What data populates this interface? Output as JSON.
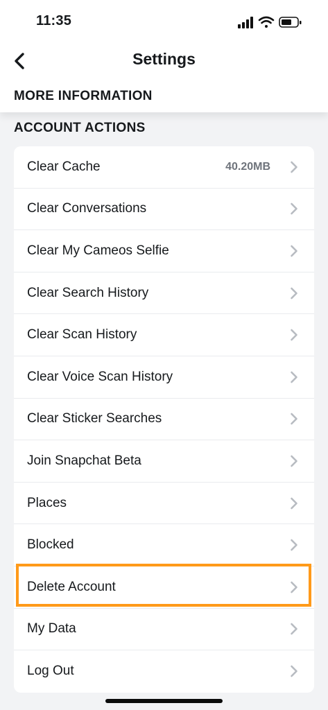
{
  "status": {
    "time": "11:35",
    "icons": [
      "cellular-signal-icon",
      "wifi-icon",
      "battery-icon"
    ]
  },
  "header": {
    "title": "Settings",
    "back_icon": "chevron-left-icon"
  },
  "sections": {
    "more_information": "MORE INFORMATION",
    "account_actions": "ACCOUNT ACTIONS"
  },
  "account_actions": {
    "items": [
      {
        "label": "Clear Cache",
        "value": "40.20MB"
      },
      {
        "label": "Clear Conversations"
      },
      {
        "label": "Clear My Cameos Selfie"
      },
      {
        "label": "Clear Search History"
      },
      {
        "label": "Clear Scan History"
      },
      {
        "label": "Clear Voice Scan History"
      },
      {
        "label": "Clear Sticker Searches"
      },
      {
        "label": "Join Snapchat Beta"
      },
      {
        "label": "Places"
      },
      {
        "label": "Blocked"
      },
      {
        "label": "Delete Account",
        "highlighted": true
      },
      {
        "label": "My Data"
      },
      {
        "label": "Log Out"
      }
    ]
  },
  "colors": {
    "highlight": "#ff9a1a",
    "chevron": "#b7bbc1",
    "value_text": "#6e737b",
    "background": "#f2f3f5"
  }
}
